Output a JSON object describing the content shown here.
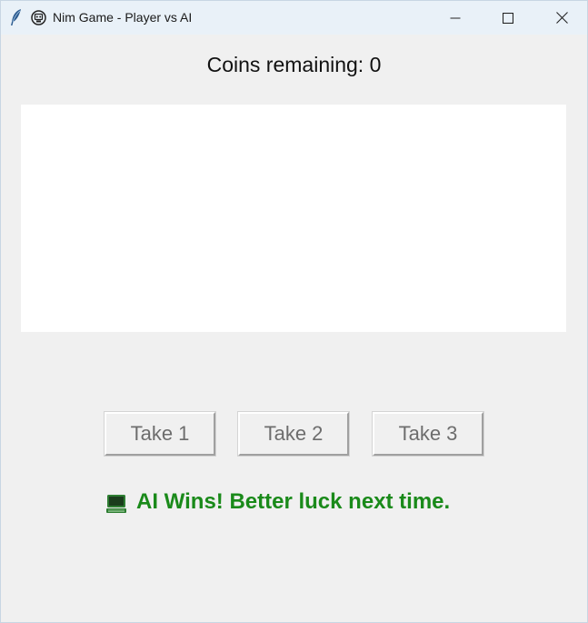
{
  "window": {
    "title": "Nim Game - Player vs AI",
    "app_icon": "feather-icon",
    "title_emoji": "robot-face-icon",
    "controls": {
      "minimize": "minimize-icon",
      "maximize": "maximize-icon",
      "close": "close-icon"
    }
  },
  "game": {
    "coins_label": "Coins remaining: 0",
    "coins_remaining": 0,
    "buttons": [
      {
        "label": "Take 1",
        "enabled": false
      },
      {
        "label": "Take 2",
        "enabled": false
      },
      {
        "label": "Take 3",
        "enabled": false
      }
    ],
    "result": {
      "icon": "computer-icon",
      "text": "AI Wins! Better luck next time.",
      "color": "#1a8a1a"
    }
  },
  "colors": {
    "titlebar": "#e9f1f8",
    "background": "#f0f0f0",
    "canvas": "#ffffff",
    "disabled_text": "#6d6d6d"
  }
}
